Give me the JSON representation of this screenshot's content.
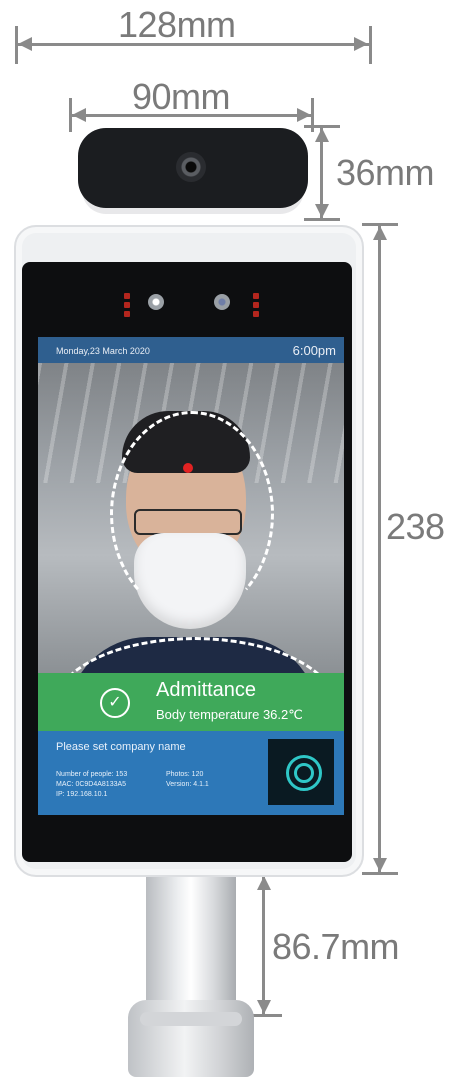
{
  "dimensions": {
    "total_width": "128mm",
    "camera_width": "90mm",
    "camera_height": "36mm",
    "screen_height": "238",
    "pole_height": "86.7mm"
  },
  "screen": {
    "date": "Monday,23 March 2020",
    "time": "6:00pm",
    "status_title": "Admittance",
    "status_subtitle": "Body temperature 36.2℃",
    "company_prompt": "Please set company name",
    "stats": {
      "people_label": "Number of people: 153",
      "photos_label": "Photos: 120",
      "mac_label": "MAC: 0C9D4A8133A5",
      "version_label": "Version: 4.1.1",
      "ip_label": "IP: 192.168.10.1"
    }
  },
  "colors": {
    "accent_green": "#3fa95a",
    "panel_blue": "#2d78b8",
    "topbar_blue": "#2f5f8f",
    "dimension_gray": "#7a7a7a",
    "temp_dot_red": "#e22222"
  }
}
